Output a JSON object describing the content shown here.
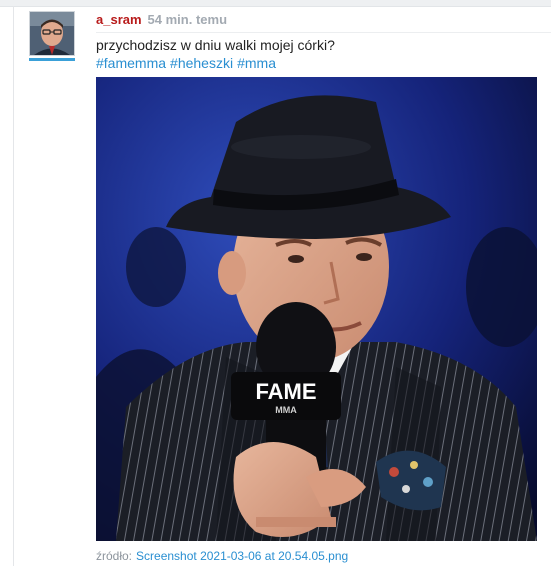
{
  "post": {
    "author": "a_sram",
    "time": "54 min. temu",
    "text": "przychodzisz w dniu walki mojej córki?",
    "tags": [
      "#famemma",
      "#heheszki",
      "#mma"
    ],
    "image": {
      "mic_logo_main": "FAME",
      "mic_logo_sub": "MMA"
    },
    "source": {
      "label": "źródło:",
      "link": "Screenshot 2021-03-06 at 20.54.05.png"
    }
  },
  "colors": {
    "username": "#b81b1b",
    "tag_link": "#2a8fd1",
    "muted": "#a3aab2",
    "accent_bar": "#3aa0d8"
  }
}
